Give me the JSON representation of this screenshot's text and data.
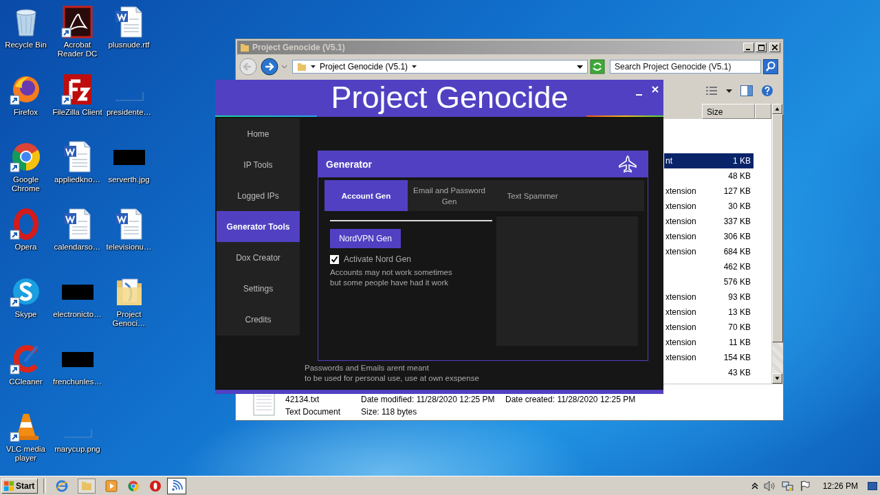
{
  "desktop_icons": [
    {
      "label": "Recycle Bin",
      "kind": "recycle",
      "shortcut": false
    },
    {
      "label": "Firefox",
      "kind": "firefox",
      "shortcut": true
    },
    {
      "label": "Google Chrome",
      "kind": "chrome",
      "shortcut": true
    },
    {
      "label": "Opera",
      "kind": "opera",
      "shortcut": true
    },
    {
      "label": "Skype",
      "kind": "skype",
      "shortcut": true
    },
    {
      "label": "CCleaner",
      "kind": "ccleaner",
      "shortcut": true
    },
    {
      "label": "VLC media player",
      "kind": "vlc",
      "shortcut": true
    },
    {
      "label": "Acrobat Reader DC",
      "kind": "acrobat",
      "shortcut": true
    },
    {
      "label": "FileZilla Client",
      "kind": "filezilla",
      "shortcut": true
    },
    {
      "label": "appliedkno…",
      "kind": "word",
      "shortcut": false
    },
    {
      "label": "calendarso…",
      "kind": "word",
      "shortcut": false
    },
    {
      "label": "electronicto…",
      "kind": "dark-image",
      "shortcut": false
    },
    {
      "label": "frenchunles…",
      "kind": "dark-image",
      "shortcut": false
    },
    {
      "label": "marycup.png",
      "kind": "blank-image",
      "shortcut": false
    },
    {
      "label": "plusnude.rtf",
      "kind": "word",
      "shortcut": false
    },
    {
      "label": "presidente…",
      "kind": "blank-image",
      "shortcut": false
    },
    {
      "label": "serverth.jpg",
      "kind": "dark-image",
      "shortcut": false
    },
    {
      "label": "televisionu…",
      "kind": "word",
      "shortcut": false
    },
    {
      "label": "Project Genoci…",
      "kind": "folder",
      "shortcut": false
    }
  ],
  "explorer": {
    "title": "Project Genocide (V5.1)",
    "address": "Project Genocide (V5.1)",
    "search_placeholder": "Search Project Genocide (V5.1)",
    "column": "Size",
    "files": [
      {
        "type": "nt",
        "size": "1 KB",
        "selected": true
      },
      {
        "size": "48 KB",
        "selected": false
      },
      {
        "type": "xtension",
        "size": "127 KB",
        "selected": false
      },
      {
        "type": "xtension",
        "size": "30 KB",
        "selected": false
      },
      {
        "type": "xtension",
        "size": "337 KB",
        "selected": false
      },
      {
        "type": "xtension",
        "size": "306 KB",
        "selected": false
      },
      {
        "type": "xtension",
        "size": "684 KB",
        "selected": false
      },
      {
        "size": "462 KB",
        "selected": false
      },
      {
        "size": "576 KB",
        "selected": false
      },
      {
        "type": "xtension",
        "size": "93 KB",
        "selected": false
      },
      {
        "type": "xtension",
        "size": "13 KB",
        "selected": false
      },
      {
        "type": "xtension",
        "size": "70 KB",
        "selected": false
      },
      {
        "type": "xtension",
        "size": "11 KB",
        "selected": false
      },
      {
        "type": "xtension",
        "size": "154 KB",
        "selected": false
      },
      {
        "size": "43 KB",
        "selected": false
      }
    ],
    "details": {
      "name": "42134.txt",
      "modified": "Date modified: 11/28/2020 12:25 PM",
      "created": "Date created: 11/28/2020 12:25 PM",
      "type": "Text Document",
      "size": "Size: 118 bytes"
    }
  },
  "app": {
    "title": "Project Genocide",
    "nav": [
      {
        "label": "Home",
        "selected": false
      },
      {
        "label": "IP Tools",
        "selected": false
      },
      {
        "label": "Logged IPs",
        "selected": false
      },
      {
        "label": "Generator Tools",
        "selected": true
      },
      {
        "label": "Dox Creator",
        "selected": false
      },
      {
        "label": "Settings",
        "selected": false
      },
      {
        "label": "Credits",
        "selected": false
      }
    ],
    "panel": {
      "title": "Generator",
      "tabs": [
        {
          "label": "Account Gen",
          "selected": true
        },
        {
          "label": "Email and Password Gen",
          "selected": false
        },
        {
          "label": "Text Spammer",
          "selected": false
        }
      ],
      "button": "NordVPN Gen",
      "checkbox": {
        "label": "Activate Nord Gen",
        "checked": true
      },
      "note": "Accounts may not work sometimes\nbut some people have had it work"
    },
    "footer": "Passwords and Emails arent meant\nto be used for personal use, use at own exspense"
  },
  "taskbar": {
    "start": "Start",
    "time": "12:26 PM"
  }
}
